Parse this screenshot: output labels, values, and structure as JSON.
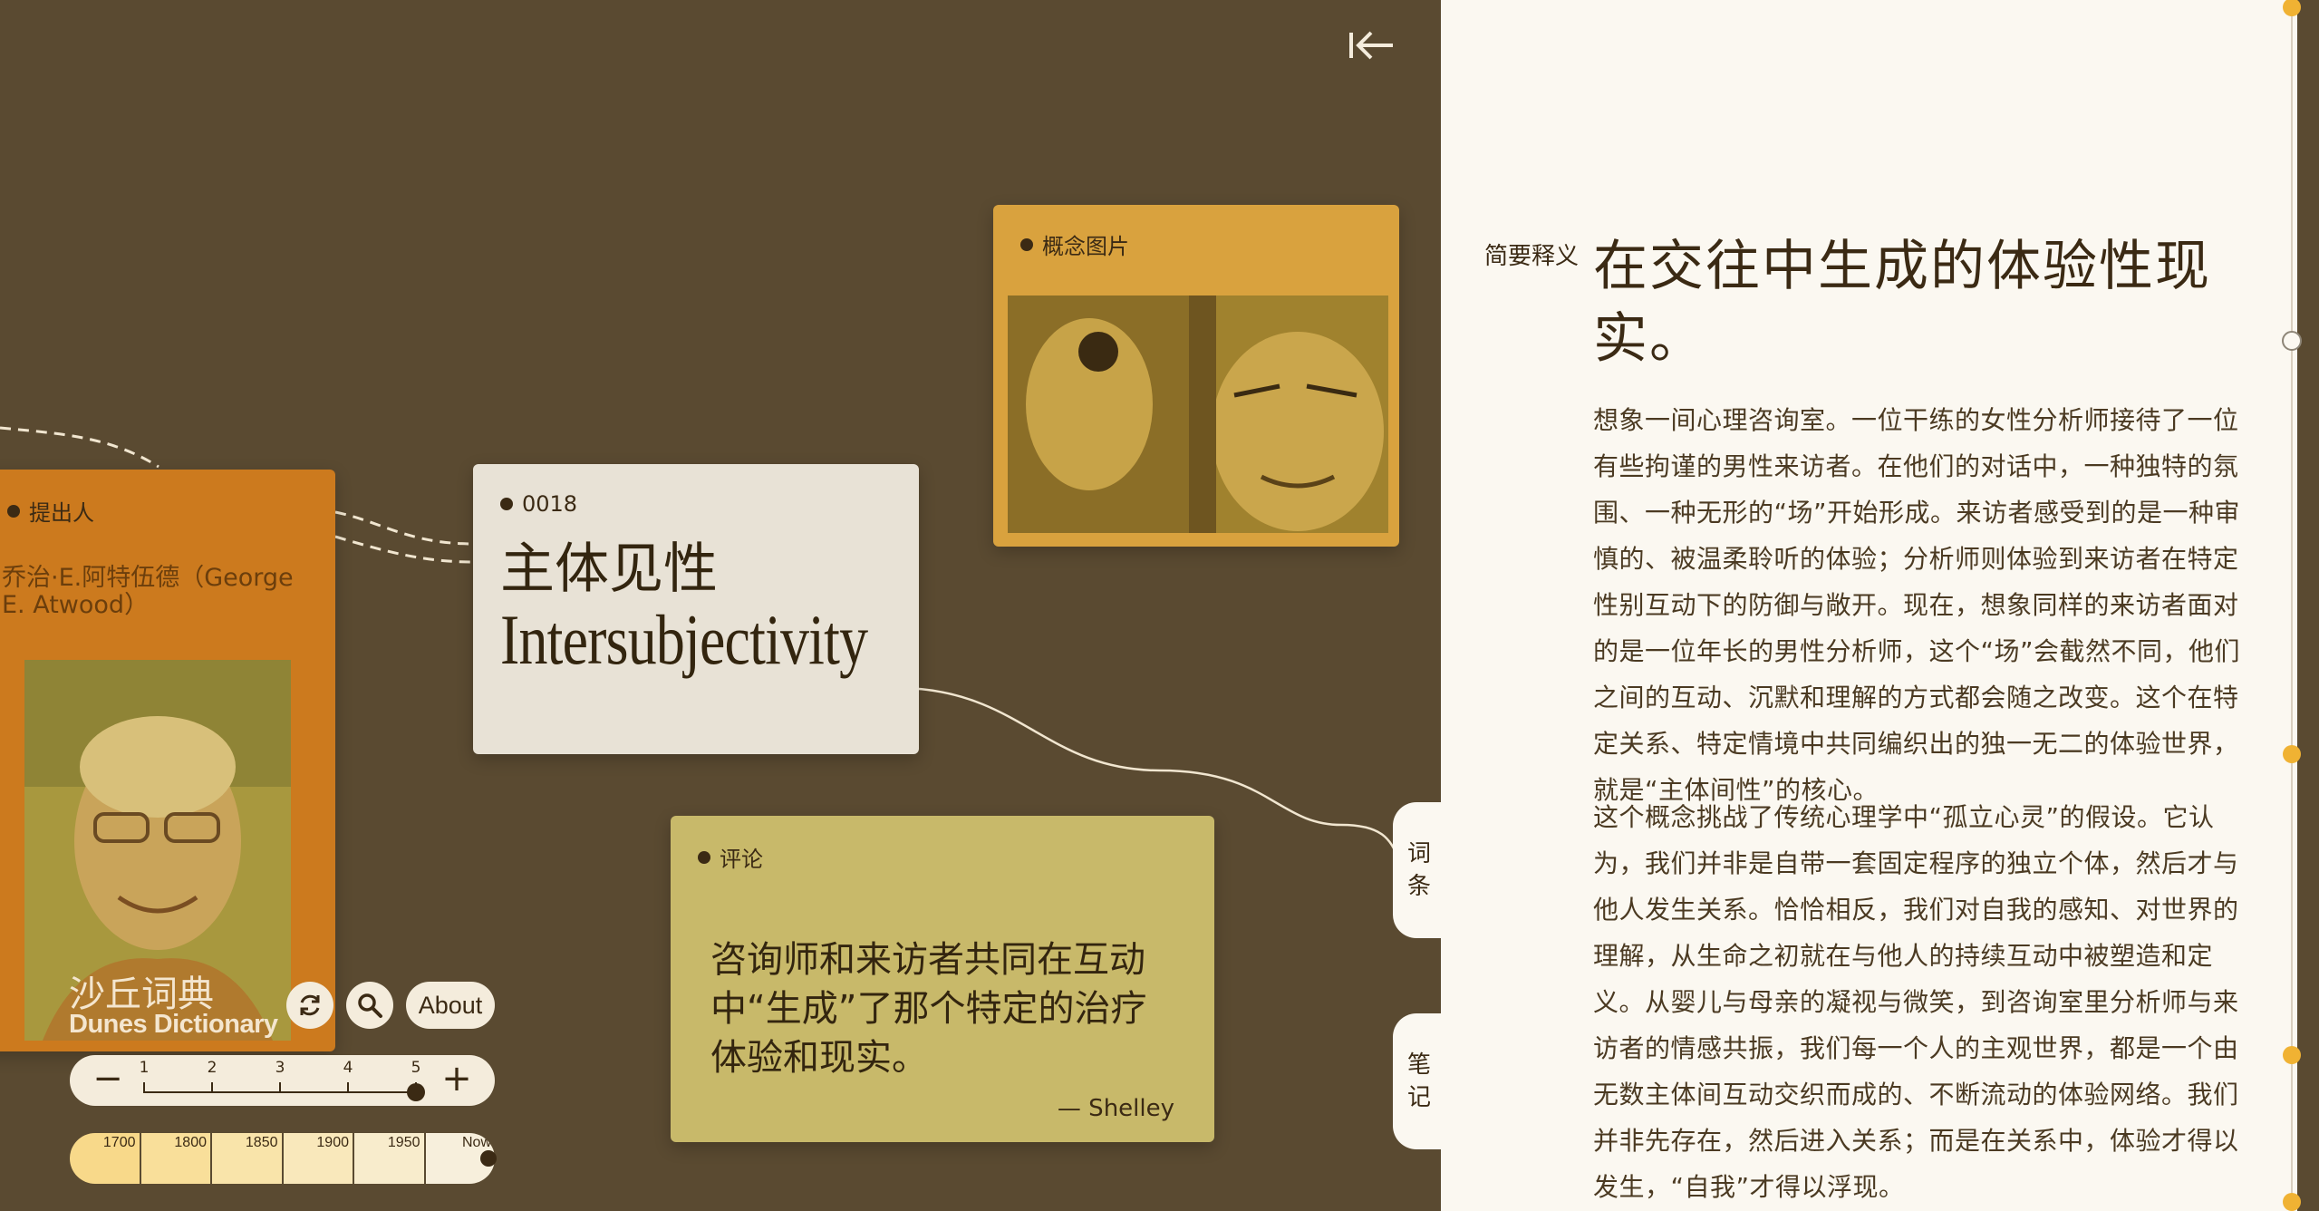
{
  "app": {
    "logo_zh": "沙丘词典",
    "logo_en": "Dunes Dictionary"
  },
  "controls": {
    "refresh_icon": "refresh-icon",
    "search_icon": "search-icon",
    "about_label": "About",
    "zoom": {
      "minus": "−",
      "plus": "+",
      "ticks": [
        "1",
        "2",
        "3",
        "4",
        "5"
      ],
      "current": 5
    },
    "timeline": {
      "eras": [
        "1700",
        "1800",
        "1850",
        "1900",
        "1950",
        "Now"
      ],
      "colors": [
        "#f8d98a",
        "#f9df9a",
        "#f9e4aa",
        "#f9e8bb",
        "#f8eccc",
        "#f7efdc"
      ]
    }
  },
  "cards": {
    "proposer": {
      "tag": "提出人",
      "name": "乔治·E.阿特伍德（George E. Atwood）"
    },
    "term": {
      "tag": "0018",
      "title_zh": "主体见性",
      "title_en": "Intersubjectivity"
    },
    "image": {
      "tag": "概念图片"
    },
    "comment": {
      "tag": "评论",
      "text": "咨询师和来访者共同在互动中“生成”了那个特定的治疗体验和现实。",
      "author": "— Shelley"
    }
  },
  "side_tabs": {
    "entry": [
      "词",
      "条"
    ],
    "notes": [
      "笔",
      "记"
    ]
  },
  "panel": {
    "label": "简要释义",
    "title": "在交往中生成的体验性现实。",
    "paragraphs": [
      "想象一间心理咨询室。一位干练的女性分析师接待了一位有些拘谨的男性来访者。在他们的对话中，一种独特的氛围、一种无形的“场”开始形成。来访者感受到的是一种审慎的、被温柔聆听的体验；分析师则体验到来访者在特定性别互动下的防御与敞开。现在，想象同样的来访者面对的是一位年长的男性分析师，这个“场”会截然不同，他们之间的互动、沉默和理解的方式都会随之改变。这个在特定关系、特定情境中共同编织出的独一无二的体验世界，就是“主体间性”的核心。",
      "这个概念挑战了传统心理学中“孤立心灵”的假设。它认为，我们并非是自带一套固定程序的独立个体，然后才与他人发生关系。恰恰相反，我们对自我的感知、对世界的理解，从生命之初就在与他人的持续互动中被塑造和定义。从婴儿与母亲的凝视与微笑，到咨询室里分析师与来访者的情感共振，我们每一个人的主观世界，都是一个由无数主体间互动交织而成的、不断流动的体验网络。我们并非先存在，然后进入关系；而是在关系中，体验才得以发生，“自我”才得以浮现。"
    ]
  },
  "colors": {
    "canvas": "#5a4a31",
    "panel": "#fbf8f1",
    "accent": "#f0b233"
  }
}
